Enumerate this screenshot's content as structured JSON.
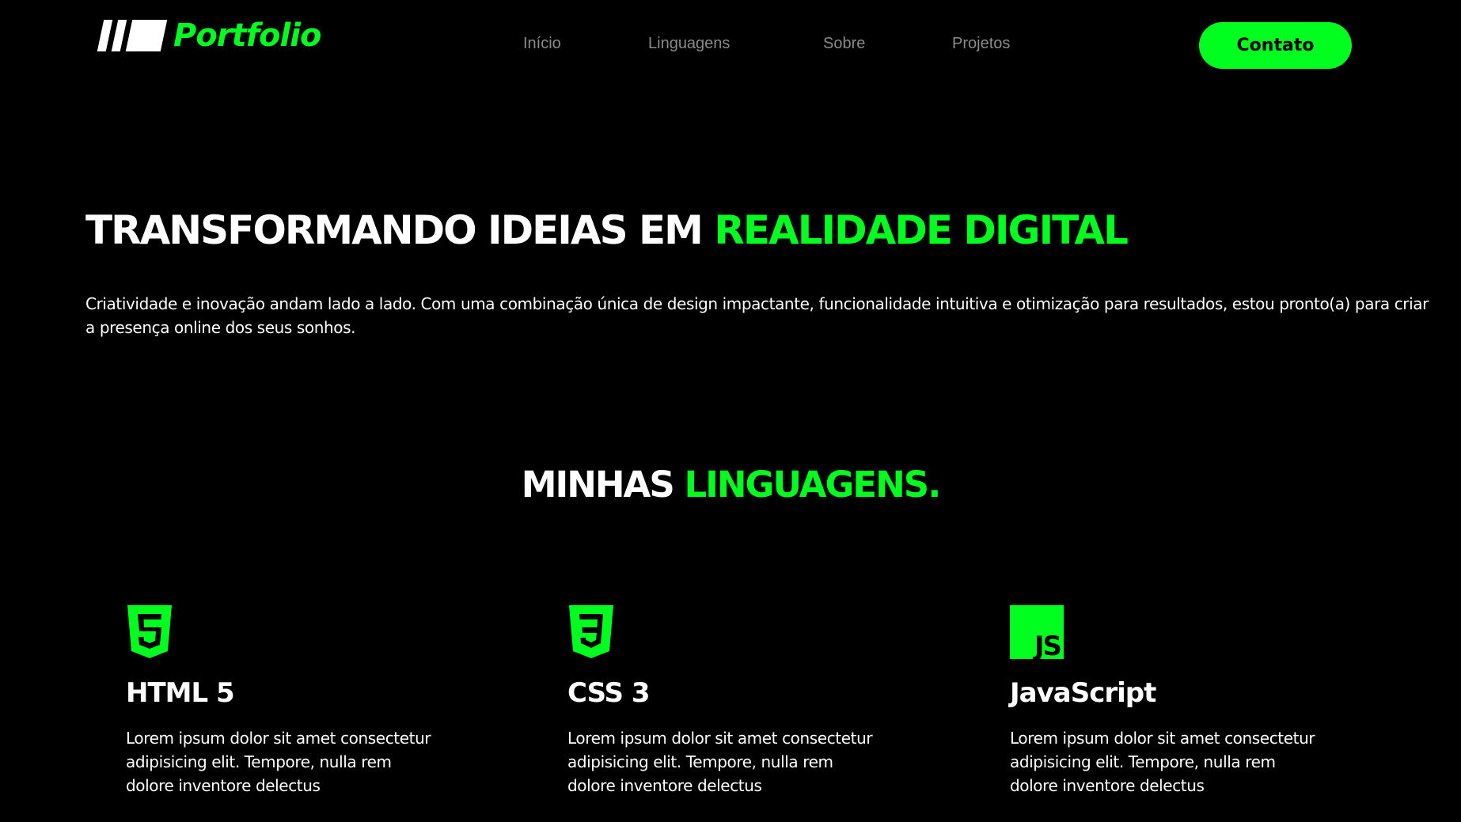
{
  "header": {
    "logo_text": "Portfolio",
    "nav": [
      "Início",
      "Linguagens",
      "Sobre",
      "Projetos"
    ],
    "contact_label": "Contato"
  },
  "hero": {
    "title_white": "TRANSFORMANDO IDEIAS EM ",
    "title_green": "REALIDADE DIGITAL",
    "text": "Criatividade e inovação andam lado a lado. Com uma combinação única de design impactante, funcionalidade intuitiva e otimização para resultados, estou pronto(a) para criar a presença online dos seus sonhos."
  },
  "languages": {
    "title_white": "MINHAS ",
    "title_green": "LINGUAGENS.",
    "items": [
      {
        "icon": "html5-icon",
        "name": "HTML 5",
        "desc": "Lorem ipsum dolor sit amet consectetur adipisicing elit. Tempore, nulla rem dolore inventore delectus"
      },
      {
        "icon": "css3-icon",
        "name": "CSS 3",
        "desc": "Lorem ipsum dolor sit amet consectetur adipisicing elit. Tempore, nulla rem dolore inventore delectus"
      },
      {
        "icon": "javascript-icon",
        "name": "JavaScript",
        "desc": "Lorem ipsum dolor sit amet consectetur adipisicing elit. Tempore, nulla rem dolore inventore delectus"
      }
    ]
  },
  "colors": {
    "accent": "#00ff1e",
    "background": "#000000",
    "nav_text": "#8a8a8a"
  }
}
